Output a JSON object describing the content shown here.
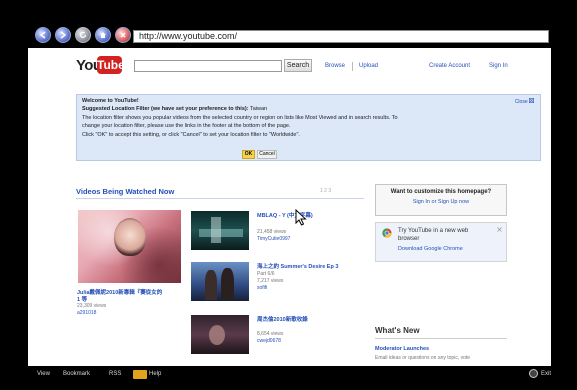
{
  "browser": {
    "address": "http://www.youtube.com/",
    "nav_icons": [
      "back-icon",
      "forward-icon",
      "reload-icon",
      "home-icon",
      "stop-icon"
    ]
  },
  "youtube": {
    "logo_you": "You",
    "logo_tube": "Tube",
    "search_button": "Search",
    "links": {
      "browse": "Browse",
      "upload": "Upload",
      "create_account": "Create Account",
      "sign_in": "Sign In"
    }
  },
  "info_box": {
    "welcome": "Welcome to YouTube!",
    "filter_heading": "Suggested Location Filter (we have set your preference to this):",
    "filter_value": "Taiwan",
    "line1": "The location filter shows you popular videos from the selected country or region on lists like Most Viewed and in search results. To",
    "line2": "change your location filter, please use the links in the footer at the bottom of the page.",
    "line3": "Click \"OK\" to accept this setting, or click \"Cancel\" to set your location filter to \"Worldwide\".",
    "close_label": "Close",
    "ok_label": "OK",
    "cancel_label": "Cancel"
  },
  "videos_section": {
    "title": "Videos Being Watched Now",
    "pager": "1  2  3",
    "featured": {
      "title_line1": "Julia戴佩妮2010新專輯『賽從女的",
      "title_line2": "1 等",
      "views": "23,309 views",
      "user": "a291018"
    },
    "items": [
      {
        "title": "MBLAQ - Y (中文字幕)",
        "title2": "",
        "views": "21,458 views",
        "user": "TimyCutie0997"
      },
      {
        "title": "海上之約 Summer's Desire Ep 3",
        "title2": "Part 6/6",
        "views": "7,217 views",
        "user": "sofifi"
      },
      {
        "title": "周杰倫2010新歌收錄",
        "title2": "",
        "views": "8,654 views",
        "user": "cwejd0678"
      }
    ]
  },
  "sidebar": {
    "customize_heading": "Want to customize this homepage?",
    "customize_link": "Sign In or Sign Up now",
    "chrome_line1": "Try YouTube in a new web",
    "chrome_line2": "browser",
    "chrome_link": "Download Google Chrome",
    "whats_new_title": "What's New",
    "whats_new_link": "Moderator Launches",
    "whats_new_text": "Email ideas or questions on any topic, vote"
  },
  "bottom_bar": {
    "view": "View",
    "bookmark": "Bookmark",
    "rss": "RSS",
    "help": "Help",
    "exit": "Exit"
  },
  "colors": {
    "link": "#2650b8",
    "logo_red": "#d32222",
    "info_bg": "#dce7f7",
    "ok_button": "#f6d24c"
  }
}
